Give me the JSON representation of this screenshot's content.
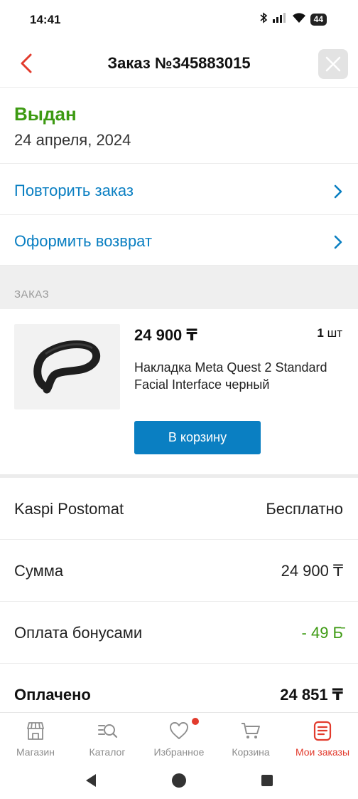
{
  "status_bar": {
    "time": "14:41",
    "battery": "44"
  },
  "header": {
    "title": "Заказ №345883015"
  },
  "order_status": {
    "title": "Выдан",
    "date": "24 апреля, 2024"
  },
  "actions": [
    {
      "label": "Повторить заказ"
    },
    {
      "label": "Оформить возврат"
    }
  ],
  "section": {
    "label": "ЗАКАЗ"
  },
  "product": {
    "price": "24 900 ₸",
    "qty_number": "1",
    "qty_unit": "шт",
    "name": "Накладка Meta Quest 2 Standard Facial Interface черный",
    "cart_button": "В корзину"
  },
  "summary": [
    {
      "label": "Kaspi Postomat",
      "value": "Бесплатно",
      "color": "#222222"
    },
    {
      "label": "Сумма",
      "value": "24 900 ₸",
      "color": "#222222"
    },
    {
      "label": "Оплата бонусами",
      "value": "- 49 Б̄",
      "color": "#3d9a12"
    },
    {
      "label": "Оплачено",
      "value": "24 851 ₸",
      "color": "#111111"
    }
  ],
  "bottom_nav": [
    {
      "label": "Магазин",
      "icon": "store-icon"
    },
    {
      "label": "Каталог",
      "icon": "catalog-search-icon"
    },
    {
      "label": "Избранное",
      "icon": "heart-icon"
    },
    {
      "label": "Корзина",
      "icon": "cart-icon"
    },
    {
      "label": "Мои заказы",
      "icon": "orders-icon",
      "active": true
    }
  ],
  "colors": {
    "accent_blue": "#0a7fc2",
    "status_green": "#3d9a12",
    "brand_red": "#e23b2d"
  }
}
